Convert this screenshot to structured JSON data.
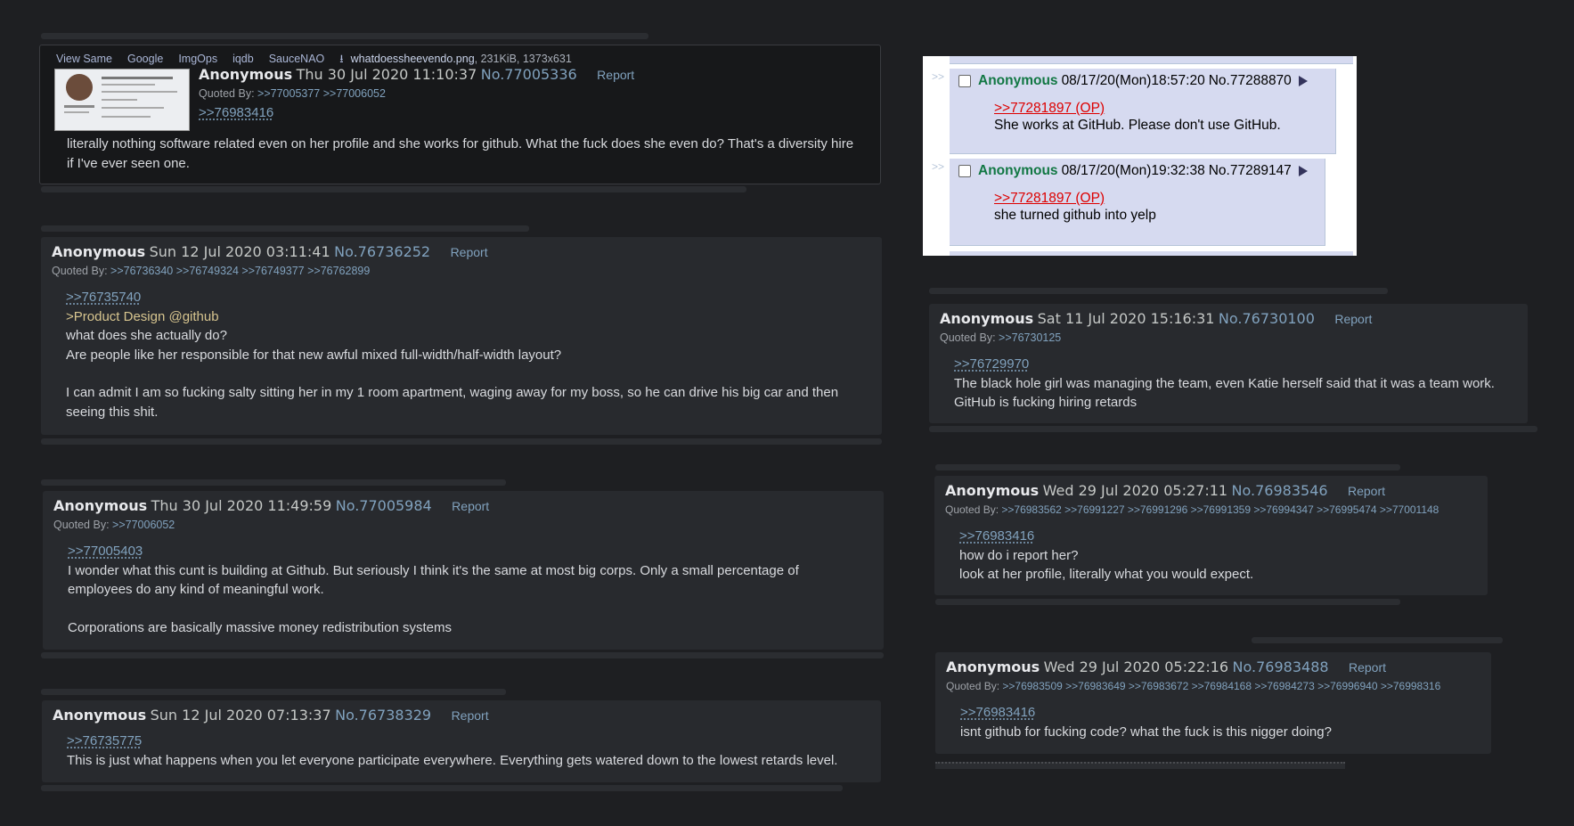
{
  "colors": {
    "background": "#1e1f22",
    "post_bg": "#282a2e",
    "link": "#81a2be",
    "greentext": "#d7c58f",
    "inset_post_bg": "#d6daf0",
    "inset_quote": "#dd0000"
  },
  "top_post": {
    "file_links": [
      "View Same",
      "Google",
      "ImgOps",
      "iqdb",
      "SauceNAO"
    ],
    "file_name": "whatdoessheevendo.png",
    "file_meta": ", 231KiB, 1373x631",
    "name": "Anonymous",
    "date": "Thu 30 Jul 2020 11:10:37",
    "number": "No.77005336",
    "report": "Report",
    "quoted_by_label": "Quoted By:",
    "quoted_by": ">>77005377 >>77006052",
    "reply_link": ">>76983416",
    "text": "literally nothing software related even on her profile and she works for github. What the fuck does she even do? That's a diversity hire if I've ever seen one."
  },
  "post2": {
    "name": "Anonymous",
    "date": "Sun 12 Jul 2020 03:11:41",
    "number": "No.76736252",
    "report": "Report",
    "quoted_by_label": "Quoted By:",
    "quoted_by": ">>76736340 >>76749324 >>76749377 >>76762899",
    "reply_link": ">>76735740",
    "greentext": ">Product Design @github",
    "line1": "what does she actually do?",
    "line2": "Are people like her responsible for that new awful mixed full-width/half-width layout?",
    "line3": "I can admit I am so fucking salty sitting her in my 1 room apartment, waging away for my boss, so he can drive his big car and then seeing this shit."
  },
  "post3": {
    "name": "Anonymous",
    "date": "Thu 30 Jul 2020 11:49:59",
    "number": "No.77005984",
    "report": "Report",
    "quoted_by_label": "Quoted By:",
    "quoted_by": ">>77006052",
    "reply_link": ">>77005403",
    "line1": "I wonder what this cunt is building at Github. But seriously I think it's the same at most big corps. Only a small percentage of employees do any kind of meaningful work.",
    "line2": "Corporations are basically massive money redistribution systems"
  },
  "post4": {
    "name": "Anonymous",
    "date": "Sun 12 Jul 2020 07:13:37",
    "number": "No.76738329",
    "report": "Report",
    "reply_link": ">>76735775",
    "text": "This is just what happens when you let everyone participate everywhere. Everything gets watered down to the lowest retards level."
  },
  "inset": {
    "arrows": ">>",
    "posts": [
      {
        "name": "Anonymous",
        "date": "08/17/20(Mon)18:57:20",
        "number": "No.77288870",
        "quote": ">>77281897 (OP)",
        "text": "She works at GitHub. Please don't use GitHub."
      },
      {
        "name": "Anonymous",
        "date": "08/17/20(Mon)19:32:38",
        "number": "No.77289147",
        "quote": ">>77281897 (OP)",
        "text": "she turned github into yelp"
      }
    ]
  },
  "post5": {
    "name": "Anonymous",
    "date": "Sat 11 Jul 2020 15:16:31",
    "number": "No.76730100",
    "report": "Report",
    "quoted_by_label": "Quoted By:",
    "quoted_by": ">>76730125",
    "reply_link": ">>76729970",
    "text": "The black hole girl was managing the team, even Katie herself said that it was a team work. GitHub is fucking hiring retards"
  },
  "post6": {
    "name": "Anonymous",
    "date": "Wed 29 Jul 2020 05:27:11",
    "number": "No.76983546",
    "report": "Report",
    "quoted_by_label": "Quoted By:",
    "quoted_by": ">>76983562 >>76991227 >>76991296 >>76991359 >>76994347 >>76995474 >>77001148",
    "reply_link": ">>76983416",
    "line1": "how do i report her?",
    "line2": "look at her profile, literally what you would expect."
  },
  "post7": {
    "name": "Anonymous",
    "date": "Wed 29 Jul 2020 05:22:16",
    "number": "No.76983488",
    "report": "Report",
    "quoted_by_label": "Quoted By:",
    "quoted_by": ">>76983509 >>76983649 >>76983672 >>76984168 >>76984273 >>76996940 >>76998316",
    "reply_link": ">>76983416",
    "text": "isnt github for fucking code? what the fuck is this nigger doing?"
  }
}
